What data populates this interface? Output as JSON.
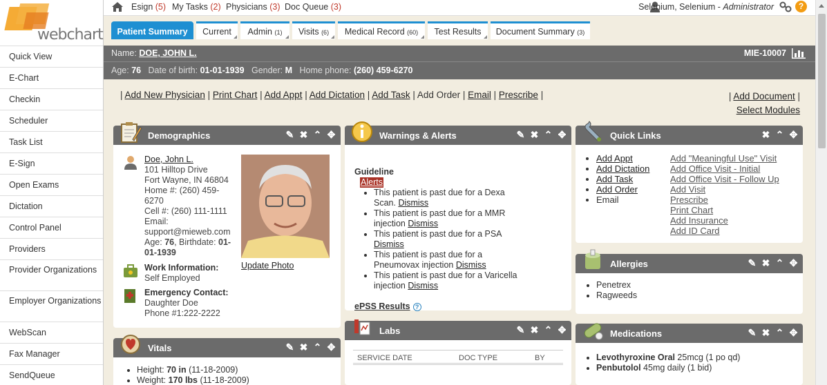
{
  "logo": {
    "text_web": "web",
    "text_chart": "chart"
  },
  "sidebar": {
    "items": [
      {
        "label": "Quick View"
      },
      {
        "label": "E-Chart"
      },
      {
        "label": "Checkin"
      },
      {
        "label": "Scheduler"
      },
      {
        "label": "Task List"
      },
      {
        "label": "E-Sign"
      },
      {
        "label": "Open Exams"
      },
      {
        "label": "Dictation"
      },
      {
        "label": "Control Panel"
      },
      {
        "label": "Providers"
      },
      {
        "label": "Provider Organizations"
      },
      {
        "label": "Employer Organizations"
      },
      {
        "label": "WebScan"
      },
      {
        "label": "Fax Manager"
      },
      {
        "label": "SendQueue"
      }
    ]
  },
  "topbar": {
    "esign": "Esign",
    "esign_count": "(5)",
    "mytasks": "My Tasks",
    "mytasks_count": "(2)",
    "physicians": "Physicians",
    "physicians_count": "(3)",
    "docqueue": "Doc Queue",
    "docqueue_count": "(3)",
    "user_name": "Selenium, Selenium - ",
    "user_role": "Administrator",
    "help": "?"
  },
  "tabs": [
    {
      "label": "Patient Summary",
      "count": ""
    },
    {
      "label": "Current",
      "count": ""
    },
    {
      "label": "Admin",
      "count": "(1)"
    },
    {
      "label": "Visits",
      "count": "(6)"
    },
    {
      "label": "Medical Record",
      "count": "(60)"
    },
    {
      "label": "Test Results",
      "count": ""
    },
    {
      "label": "Document Summary",
      "count": "(3)"
    }
  ],
  "patient": {
    "name_label": "Name:",
    "name": "DOE, JOHN L.",
    "mrn": "MIE-10007",
    "age_label": "Age:",
    "age": "76",
    "dob_label": "Date of birth:",
    "dob": "01-01-1939",
    "gender_label": "Gender:",
    "gender": "M",
    "phone_label": "Home phone:",
    "phone": "(260) 459-6270"
  },
  "actions": {
    "left": [
      "Add New Physician",
      "Print Chart",
      "Add Appt",
      "Add Dictation",
      "Add Task",
      "Add Order",
      "Email",
      "Prescribe"
    ],
    "right1": "Add Document",
    "right2": "Select Modules"
  },
  "demographics": {
    "title": "Demographics",
    "name": "Doe, John L.",
    "address1": "101 Hilltop Drive",
    "address2": "Fort Wayne, IN 46804",
    "home": "Home #: (260) 459-6270",
    "cell": "Cell #: (260) 111-1111",
    "email_label": "Email:",
    "email": "support@mieweb.com",
    "age_birth_prefix": "Age: ",
    "age": "76",
    "birth_mid": ", Birthdate: ",
    "birthdate": "01-01-1939",
    "update_photo": "Update Photo",
    "work_label": "Work Information:",
    "work_value": "Self Employed",
    "emergency_label": "Emergency Contact:",
    "emergency_name": "Daughter Doe",
    "emergency_phone": "Phone #1:222-2222"
  },
  "warnings": {
    "title": "Warnings & Alerts",
    "guideline": "Guideline",
    "alerts": "Alerts",
    "items": [
      {
        "text": "This patient is past due for a Dexa Scan. ",
        "link": "Dismiss"
      },
      {
        "text": "This patient is past due for a MMR injection ",
        "link": "Dismiss"
      },
      {
        "text": "This patient is past due for a PSA ",
        "link": "Dismiss"
      },
      {
        "text": "This patient is past due for a Pneumovax injection ",
        "link": "Dismiss"
      },
      {
        "text": "This patient is past due for a Varicella injection ",
        "link": "Dismiss"
      }
    ],
    "epss": "ePSS Results",
    "help": "?"
  },
  "quicklinks": {
    "title": "Quick Links",
    "col1": [
      "Add Appt",
      "Add Dictation",
      "Add Task",
      "Add Order",
      "Email"
    ],
    "col2": [
      "Add \"Meaningful Use\" Visit",
      "Add Office Visit - Initial",
      "Add Office Visit - Follow Up",
      "Add Visit",
      "Prescribe",
      "Print Chart",
      "Add Insurance",
      "Add ID Card"
    ]
  },
  "allergies": {
    "title": "Allergies",
    "items": [
      "Penetrex",
      "Ragweeds"
    ]
  },
  "vitals": {
    "title": "Vitals",
    "items": [
      {
        "label": "Height: ",
        "value": "70 in",
        "date": " (11-18-2009)"
      },
      {
        "label": "Weight: ",
        "value": "170 lbs",
        "date": " (11-18-2009)"
      }
    ]
  },
  "labs": {
    "title": "Labs",
    "col_date": "SERVICE DATE",
    "col_type": "DOC TYPE",
    "col_by": "BY"
  },
  "medications": {
    "title": "Medications",
    "items": [
      {
        "name": "Levothyroxine Oral",
        "dose": " 25mcg (1 po qd)"
      },
      {
        "name": "Penbutolol",
        "dose": " 45mg daily (1 bid)"
      }
    ]
  }
}
